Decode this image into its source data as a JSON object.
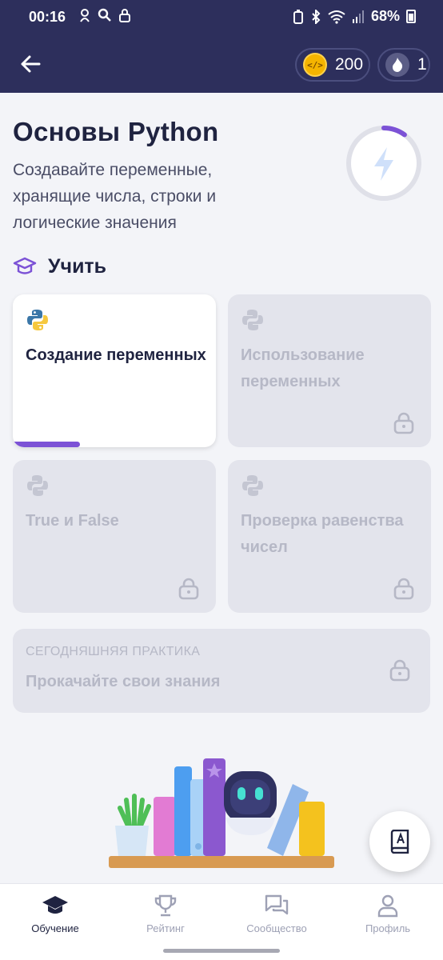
{
  "status_bar": {
    "time": "00:16",
    "battery": "68%"
  },
  "header": {
    "coins": "200",
    "streak": "1"
  },
  "course": {
    "title": "Основы Python",
    "subtitle": "Создавайте переменные, хранящие числа, строки и логические значения",
    "progress": 0.1
  },
  "section": {
    "title": "Учить"
  },
  "lessons": [
    {
      "label": "Создание переменных",
      "locked": false,
      "progress": 0.33
    },
    {
      "label": "Использование переменных",
      "locked": true
    },
    {
      "label": "True и False",
      "locked": true
    },
    {
      "label": "Проверка равенства чисел",
      "locked": true
    }
  ],
  "practice": {
    "caption": "СЕГОДНЯШНЯЯ ПРАКТИКА",
    "title": "Прокачайте свои знания",
    "locked": true
  },
  "nav": [
    {
      "label": "Обучение",
      "icon": "graduation-cap-icon",
      "active": true
    },
    {
      "label": "Рейтинг",
      "icon": "trophy-icon",
      "active": false
    },
    {
      "label": "Сообщество",
      "icon": "chat-bubbles-icon",
      "active": false
    },
    {
      "label": "Профиль",
      "icon": "person-icon",
      "active": false
    }
  ],
  "colors": {
    "header": "#2d2f5c",
    "accent": "#7c52d6",
    "card_locked": "#e3e4ec"
  }
}
